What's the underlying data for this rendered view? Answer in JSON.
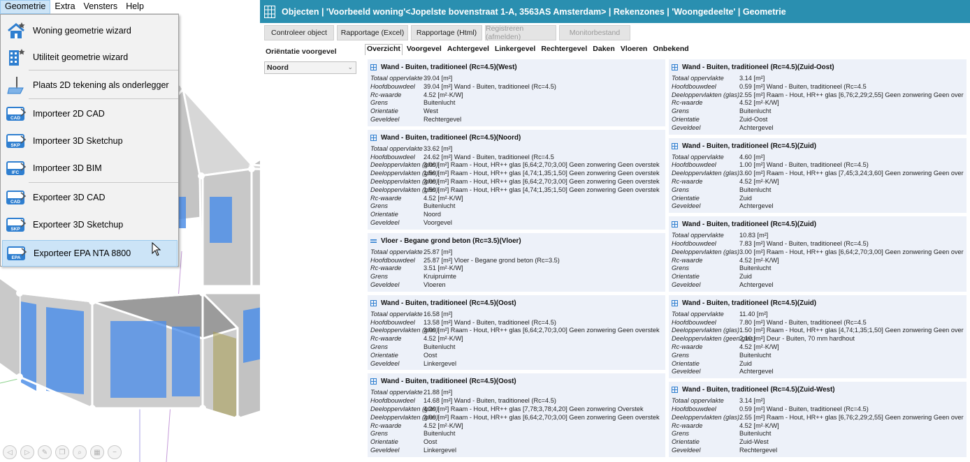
{
  "menubar": [
    {
      "label": "Geometrie",
      "active": true
    },
    {
      "label": "Extra",
      "active": false
    },
    {
      "label": "Vensters",
      "active": false
    },
    {
      "label": "Help",
      "active": false
    }
  ],
  "menu_items": [
    {
      "label": "Woning geometrie wizard",
      "icon": "house-star-icon",
      "badge": ""
    },
    {
      "label": "Utiliteit geometrie wizard",
      "icon": "building-star-icon",
      "badge": ""
    },
    {
      "label": "Plaats 2D tekening als onderlegger",
      "icon": "drawing-pen-icon",
      "badge": ""
    },
    {
      "label": "Importeer 2D CAD",
      "icon": "import-cad-icon",
      "badge": "CAD"
    },
    {
      "label": "Importeer 3D Sketchup",
      "icon": "import-skp-icon",
      "badge": "SKP"
    },
    {
      "label": "Importeer 3D BIM",
      "icon": "import-ifc-icon",
      "badge": "IFC"
    },
    {
      "label": "Exporteer 3D CAD",
      "icon": "export-cad-icon",
      "badge": "CAD"
    },
    {
      "label": "Exporteer 3D Sketchup",
      "icon": "export-skp-icon",
      "badge": "SKP"
    },
    {
      "label": "Exporteer EPA NTA 8800",
      "icon": "export-epa-icon",
      "badge": "EPA"
    }
  ],
  "app": {
    "title": "Objecten | 'Voorbeeld woning'<Jopelste bovenstraat 1-A, 3563AS Amsterdam> | Rekenzones | 'Woongedeelte' | Geometrie",
    "toolbar": [
      {
        "label": "Controleer object",
        "enabled": true
      },
      {
        "label": "Rapportage (Excel)",
        "enabled": true
      },
      {
        "label": "Rapportage (Html)",
        "enabled": true
      },
      {
        "label": "Registreren (afmelden)",
        "enabled": false
      },
      {
        "label": "Monitorbestand",
        "enabled": false
      }
    ],
    "orientation_label": "Oriëntatie voorgevel",
    "orientation_value": "Noord",
    "tabs": [
      "Overzicht",
      "Voorgevel",
      "Achtergevel",
      "Linkergevel",
      "Rechtergevel",
      "Daken",
      "Vloeren",
      "Onbekend"
    ],
    "active_tab": "Overzicht"
  },
  "cards_left": [
    {
      "title": "Wand - Buiten, traditioneel (Rc=4.5)(West)",
      "icon": "wall-icon",
      "rows": [
        [
          "Totaal oppervlakte",
          "39.04 [m²]"
        ],
        [
          "Hoofdbouwdeel",
          "39.04 [m²] Wand - Buiten, traditioneel (Rc=4.5)"
        ],
        [
          "Rc-waarde",
          "4.52 [m²·K/W]"
        ],
        [
          "Grens",
          "Buitenlucht"
        ],
        [
          "Orientatie",
          "West"
        ],
        [
          "Geveldeel",
          "Rechtergevel"
        ]
      ]
    },
    {
      "title": "Wand - Buiten, traditioneel (Rc=4.5)(Noord)",
      "icon": "wall-icon",
      "rows": [
        [
          "Totaal oppervlakte",
          "33.62 [m²]"
        ],
        [
          "Hoofdbouwdeel",
          "24.62 [m²] Wand - Buiten, traditioneel (Rc=4.5"
        ],
        [
          "Deeloppervlakten (glas)",
          "3.00 [m²] Raam - Hout, HR++ glas [6,64;2,70;3,00] Geen zonwering Geen overstek"
        ],
        [
          "Deeloppervlakten (glas)",
          "1.50 [m²] Raam - Hout, HR++ glas [4,74;1,35;1,50] Geen zonwering Geen overstek"
        ],
        [
          "Deeloppervlakten (glas)",
          "3.00 [m²] Raam - Hout, HR++ glas [6,64;2,70;3,00] Geen zonwering Geen overstek"
        ],
        [
          "Deeloppervlakten (glas)",
          "1.50 [m²] Raam - Hout, HR++ glas [4,74;1,35;1,50] Geen zonwering Geen overstek"
        ],
        [
          "Rc-waarde",
          "4.52 [m²·K/W]"
        ],
        [
          "Grens",
          "Buitenlucht"
        ],
        [
          "Orientatie",
          "Noord"
        ],
        [
          "Geveldeel",
          "Voorgevel"
        ]
      ]
    },
    {
      "title": "Vloer - Begane grond beton (Rc=3.5)(Vloer)",
      "icon": "floor-icon",
      "rows": [
        [
          "Totaal oppervlakte",
          "25.87 [m²]"
        ],
        [
          "Hoofdbouwdeel",
          "25.87 [m²] Vloer - Begane grond beton (Rc=3.5)"
        ],
        [
          "Rc-waarde",
          "3.51 [m²·K/W]"
        ],
        [
          "Grens",
          "Kruipruimte"
        ],
        [
          "Geveldeel",
          "Vloeren"
        ]
      ]
    },
    {
      "title": "Wand - Buiten, traditioneel (Rc=4.5)(Oost)",
      "icon": "wall-icon",
      "rows": [
        [
          "Totaal oppervlakte",
          "16.58 [m²]"
        ],
        [
          "Hoofdbouwdeel",
          "13.58 [m²] Wand - Buiten, traditioneel (Rc=4.5)"
        ],
        [
          "Deeloppervlakten (glas)",
          "3.00 [m²] Raam - Hout, HR++ glas [6,64;2,70;3,00] Geen zonwering Geen overstek"
        ],
        [
          "Rc-waarde",
          "4.52 [m²·K/W]"
        ],
        [
          "Grens",
          "Buitenlucht"
        ],
        [
          "Orientatie",
          "Oost"
        ],
        [
          "Geveldeel",
          "Linkergevel"
        ]
      ]
    },
    {
      "title": "Wand - Buiten, traditioneel (Rc=4.5)(Oost)",
      "icon": "wall-icon",
      "rows": [
        [
          "Totaal oppervlakte",
          "21.88 [m²]"
        ],
        [
          "Hoofdbouwdeel",
          "14.68 [m²] Wand - Buiten, traditioneel (Rc=4.5)"
        ],
        [
          "Deeloppervlakten (glas)",
          "4.20 [m²] Raam - Hout, HR++ glas [7,78;3,78;4,20] Geen zonwering Overstek"
        ],
        [
          "Deeloppervlakten (glas)",
          "3.00 [m²] Raam - Hout, HR++ glas [6,64;2,70;3,00] Geen zonwering Geen overstek"
        ],
        [
          "Rc-waarde",
          "4.52 [m²·K/W]"
        ],
        [
          "Grens",
          "Buitenlucht"
        ],
        [
          "Orientatie",
          "Oost"
        ],
        [
          "Geveldeel",
          "Linkergevel"
        ]
      ]
    }
  ],
  "cards_right": [
    {
      "title": "Wand - Buiten, traditioneel (Rc=4.5)(Zuid-Oost)",
      "icon": "wall-icon",
      "rows": [
        [
          "Totaal oppervlakte",
          "3.14 [m²]"
        ],
        [
          "Hoofdbouwdeel",
          "0.59 [m²] Wand - Buiten, traditioneel (Rc=4.5"
        ],
        [
          "Deeloppervlakten (glas)",
          "2.55 [m²] Raam - Hout, HR++ glas [6,76;2,29;2,55] Geen zonwering Geen overstek"
        ],
        [
          "Rc-waarde",
          "4.52 [m²·K/W]"
        ],
        [
          "Grens",
          "Buitenlucht"
        ],
        [
          "Orientatie",
          "Zuid-Oost"
        ],
        [
          "Geveldeel",
          "Achtergevel"
        ]
      ]
    },
    {
      "title": "Wand - Buiten, traditioneel (Rc=4.5)(Zuid)",
      "icon": "wall-icon",
      "rows": [
        [
          "Totaal oppervlakte",
          "4.60 [m²]"
        ],
        [
          "Hoofdbouwdeel",
          "1.00 [m²] Wand - Buiten, traditioneel (Rc=4.5)"
        ],
        [
          "Deeloppervlakten (glas)",
          "3.60 [m²] Raam - Hout, HR++ glas [7,45;3,24;3,60] Geen zonwering Geen overstek"
        ],
        [
          "Rc-waarde",
          "4.52 [m²·K/W]"
        ],
        [
          "Grens",
          "Buitenlucht"
        ],
        [
          "Orientatie",
          "Zuid"
        ],
        [
          "Geveldeel",
          "Achtergevel"
        ]
      ]
    },
    {
      "title": "Wand - Buiten, traditioneel (Rc=4.5)(Zuid)",
      "icon": "wall-icon",
      "rows": [
        [
          "Totaal oppervlakte",
          "10.83 [m²]"
        ],
        [
          "Hoofdbouwdeel",
          "7.83 [m²] Wand - Buiten, traditioneel (Rc=4.5)"
        ],
        [
          "Deeloppervlakten (glas)",
          "3.00 [m²] Raam - Hout, HR++ glas [6,64;2,70;3,00] Geen zonwering Geen overstek"
        ],
        [
          "Rc-waarde",
          "4.52 [m²·K/W]"
        ],
        [
          "Grens",
          "Buitenlucht"
        ],
        [
          "Orientatie",
          "Zuid"
        ],
        [
          "Geveldeel",
          "Achtergevel"
        ]
      ]
    },
    {
      "title": "Wand - Buiten, traditioneel (Rc=4.5)(Zuid)",
      "icon": "wall-icon",
      "rows": [
        [
          "Totaal oppervlakte",
          "11.40 [m²]"
        ],
        [
          "Hoofdbouwdeel",
          "7.80 [m²] Wand - Buiten, traditioneel (Rc=4.5"
        ],
        [
          "Deeloppervlakten (glas)",
          "1.50 [m²] Raam - Hout, HR++ glas [4,74;1,35;1,50] Geen zonwering Geen overstek"
        ],
        [
          "Deeloppervlakten (geen glas)",
          "2.10 [m²] Deur - Buiten, 70 mm hardhout"
        ],
        [
          "Rc-waarde",
          "4.52 [m²·K/W]"
        ],
        [
          "Grens",
          "Buitenlucht"
        ],
        [
          "Orientatie",
          "Zuid"
        ],
        [
          "Geveldeel",
          "Achtergevel"
        ]
      ]
    },
    {
      "title": "Wand - Buiten, traditioneel (Rc=4.5)(Zuid-West)",
      "icon": "wall-icon",
      "rows": [
        [
          "Totaal oppervlakte",
          "3.14 [m²]"
        ],
        [
          "Hoofdbouwdeel",
          "0.59 [m²] Wand - Buiten, traditioneel (Rc=4.5)"
        ],
        [
          "Deeloppervlakten (glas)",
          "2.55 [m²] Raam - Hout, HR++ glas [6,76;2,29;2,55] Geen zonwering Geen overstek"
        ],
        [
          "Rc-waarde",
          "4.52 [m²·K/W]"
        ],
        [
          "Grens",
          "Buitenlucht"
        ],
        [
          "Orientatie",
          "Zuid-West"
        ],
        [
          "Geveldeel",
          "Rechtergevel"
        ]
      ]
    }
  ],
  "colors": {
    "titlebar": "#2a8fb0",
    "card_bg": "#edf1f9",
    "window_blue": "#3f86e0",
    "menu_hover": "#cce4f7"
  }
}
